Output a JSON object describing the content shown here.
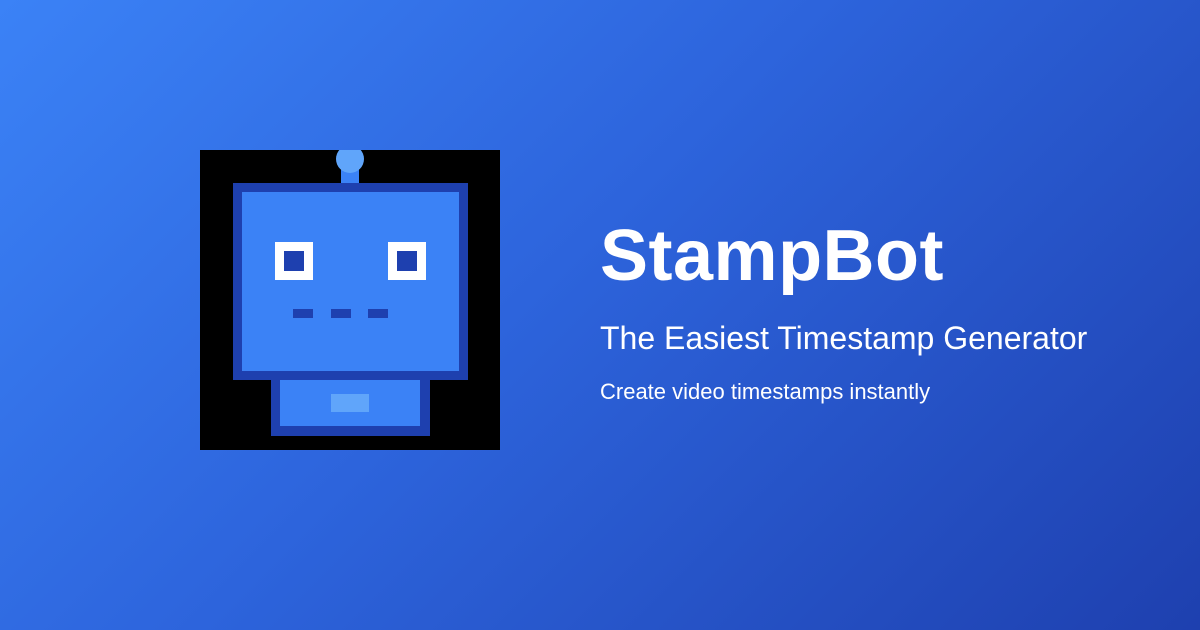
{
  "brand": {
    "name": "StampBot",
    "subtitle": "The Easiest Timestamp Generator",
    "tagline": "Create video timestamps instantly"
  },
  "logo": {
    "icon": "robot-icon"
  },
  "colors": {
    "background_start": "#3b82f6",
    "background_end": "#1e40af",
    "logo_background": "#000000",
    "robot_body": "#3b82f6",
    "robot_outline": "#1e40af",
    "robot_antenna_tip": "#60a5fa",
    "text": "#ffffff"
  }
}
